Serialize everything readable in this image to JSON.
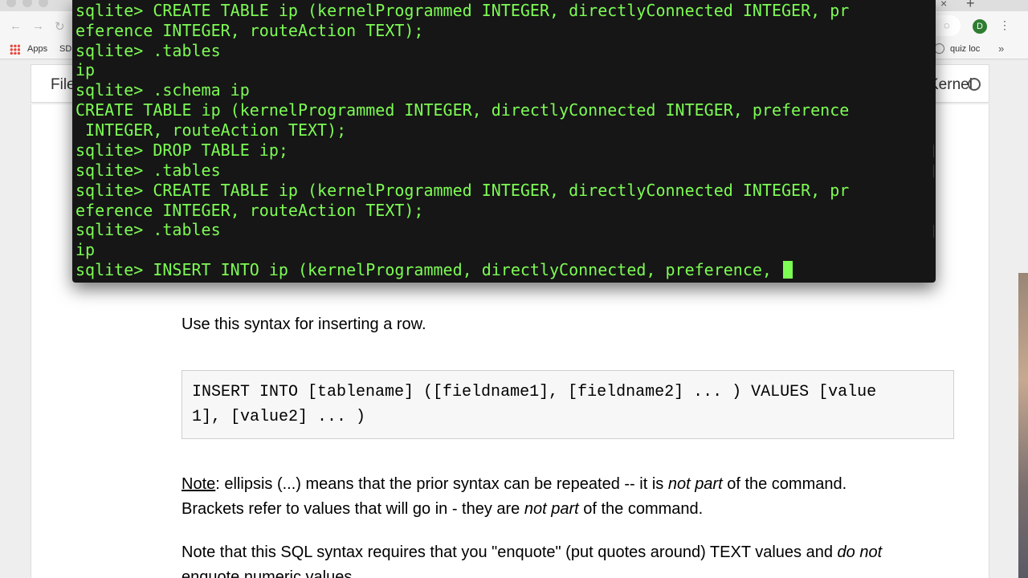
{
  "browser": {
    "tab_close_glyph": "×",
    "new_tab_glyph": "+",
    "back_glyph": "←",
    "forward_glyph": "→",
    "reload_glyph": "↻",
    "profile_initial": "D",
    "menu_glyph": "⋮",
    "bookmarks": {
      "apps_label": "Apps",
      "sd_label": "SD",
      "quiz_label": "quiz loc",
      "overflow_glyph": "»"
    }
  },
  "notebook": {
    "menu_file": "File",
    "menu_kernel": "Kernel"
  },
  "terminal": {
    "lines": [
      "sqlite> CREATE TABLE ip (kernelProgrammed INTEGER, directlyConnected INTEGER, pr",
      "eference INTEGER, routeAction TEXT);",
      "sqlite> .tables",
      "ip",
      "sqlite> .schema ip",
      "CREATE TABLE ip (kernelProgrammed INTEGER, directlyConnected INTEGER, preference",
      " INTEGER, routeAction TEXT);",
      "sqlite> DROP TABLE ip;",
      "sqlite> .tables",
      "sqlite> CREATE TABLE ip (kernelProgrammed INTEGER, directlyConnected INTEGER, pr",
      "eference INTEGER, routeAction TEXT);",
      "sqlite> .tables",
      "ip",
      "sqlite> INSERT INTO ip (kernelProgrammed, directlyConnected, preference, "
    ]
  },
  "content": {
    "syntax_intro": "Use this syntax for inserting a row.",
    "code_line1": "INSERT INTO [tablename] ([fieldname1], [fieldname2] ... ) VALUES [value",
    "code_line2": "1], [value2] ... )",
    "note_label": "Note",
    "note_line1_a": ": ellipsis (...) means that the prior syntax can be repeated -- it is ",
    "note_line1_em": "not part",
    "note_line1_b": " of the command.",
    "note_line2_a": "Brackets refer to values that will go in - they are ",
    "note_line2_em": "not part",
    "note_line2_b": " of the command.",
    "enquote_a": "Note that this SQL syntax requires that you \"enquote\" (put quotes around) TEXT values and ",
    "enquote_em": "do not",
    "enquote_line2": "enquote numeric values."
  }
}
